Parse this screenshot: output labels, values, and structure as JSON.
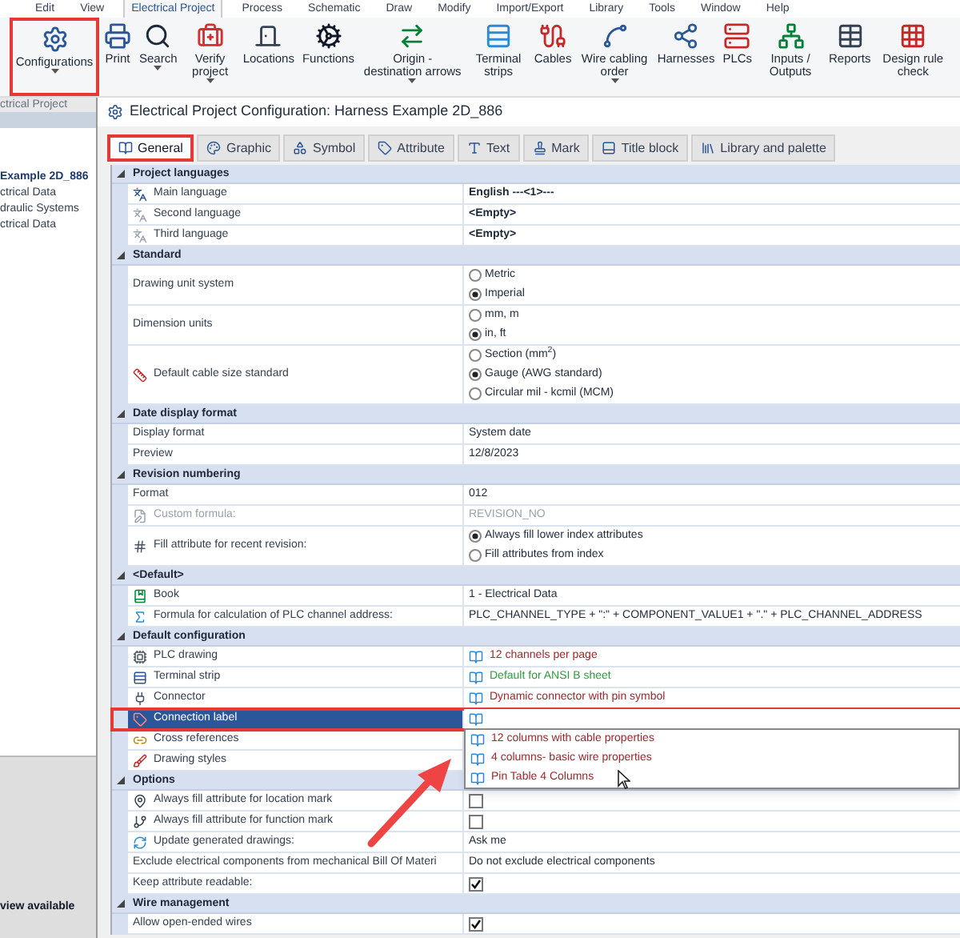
{
  "menu_tabs": [
    {
      "label": "Edit",
      "selected": false
    },
    {
      "label": "View",
      "selected": false
    },
    {
      "label": "Electrical Project",
      "selected": true
    },
    {
      "label": "Process",
      "selected": false
    },
    {
      "label": "Schematic",
      "selected": false
    },
    {
      "label": "Draw",
      "selected": false
    },
    {
      "label": "Modify",
      "selected": false
    },
    {
      "label": "Import/Export",
      "selected": false
    },
    {
      "label": "Library",
      "selected": false
    },
    {
      "label": "Tools",
      "selected": false
    },
    {
      "label": "Window",
      "selected": false
    },
    {
      "label": "Help",
      "selected": false
    }
  ],
  "ribbon": {
    "buttons": [
      {
        "label": "Configurations",
        "kind": "configurations",
        "dropdown": true,
        "annotated": true
      },
      {
        "label": "Print",
        "kind": "print",
        "dropdown": false,
        "annotated": false
      },
      {
        "label": "Search",
        "kind": "search",
        "dropdown": true,
        "annotated": false
      },
      {
        "label": "Verify project",
        "kind": "verify",
        "dropdown": true,
        "annotated": false
      },
      {
        "label": "Locations",
        "kind": "locations",
        "dropdown": false,
        "annotated": false
      },
      {
        "label": "Functions",
        "kind": "functions",
        "dropdown": false,
        "annotated": false
      },
      {
        "label": "Origin - destination arrows",
        "kind": "arrows",
        "dropdown": true,
        "annotated": false
      },
      {
        "label": "Terminal strips",
        "kind": "terminals",
        "dropdown": false,
        "annotated": false
      },
      {
        "label": "Cables",
        "kind": "cables",
        "dropdown": false,
        "annotated": false
      },
      {
        "label": "Wire cabling order",
        "kind": "wires",
        "dropdown": true,
        "annotated": false
      },
      {
        "label": "Harnesses",
        "kind": "harnesses",
        "dropdown": false,
        "annotated": false
      },
      {
        "label": "PLCs",
        "kind": "plcs",
        "dropdown": false,
        "annotated": false
      },
      {
        "label": "Inputs / Outputs",
        "kind": "io",
        "dropdown": false,
        "annotated": false
      },
      {
        "label": "Reports",
        "kind": "reports",
        "dropdown": false,
        "annotated": false
      },
      {
        "label": "Design rule check",
        "kind": "drc",
        "dropdown": false,
        "annotated": false
      }
    ],
    "group_label": "ctrical Project"
  },
  "tree": {
    "items": [
      {
        "label": "Example 2D_886",
        "kind": "project"
      },
      {
        "label": "ctrical Data",
        "kind": "book"
      },
      {
        "label": "draulic Systems",
        "kind": "book"
      },
      {
        "label": "ctrical Data",
        "kind": "book"
      }
    ]
  },
  "preview_text": "view available",
  "dialog": {
    "title": "Electrical Project Configuration: Harness Example 2D_886",
    "tabs": [
      {
        "label": "General",
        "selected": true,
        "annotated": true
      },
      {
        "label": "Graphic",
        "selected": false,
        "annotated": false
      },
      {
        "label": "Symbol",
        "selected": false,
        "annotated": false
      },
      {
        "label": "Attribute",
        "selected": false,
        "annotated": false
      },
      {
        "label": "Text",
        "selected": false,
        "annotated": false
      },
      {
        "label": "Mark",
        "selected": false,
        "annotated": false
      },
      {
        "label": "Title block",
        "selected": false,
        "annotated": false
      },
      {
        "label": "Library and palette",
        "selected": false,
        "annotated": false
      }
    ],
    "sections": [
      {
        "title": "Project languages",
        "rows": [
          {
            "label": "Main language",
            "kind": "text",
            "value": "English  ---<1>---",
            "bold": true,
            "disabled": false,
            "selected": false
          },
          {
            "label": "Second language",
            "kind": "text",
            "value": "<Empty>",
            "bold": true,
            "disabled": false,
            "selected": false
          },
          {
            "label": "Third language",
            "kind": "text",
            "value": "<Empty>",
            "bold": true,
            "disabled": false,
            "selected": false
          }
        ]
      },
      {
        "title": "Standard",
        "rows": [
          {
            "label": "Drawing unit system",
            "kind": "radio",
            "options": [
              {
                "label": "Metric",
                "selected": false
              },
              {
                "label": "Imperial",
                "selected": true
              }
            ],
            "disabled": false,
            "selected": false
          },
          {
            "label": "Dimension units",
            "kind": "radio",
            "options": [
              {
                "label": "mm, m",
                "selected": false
              },
              {
                "label": "in, ft",
                "selected": true
              }
            ],
            "disabled": false,
            "selected": false
          },
          {
            "label": "Default cable size standard",
            "kind": "radio",
            "options": [
              {
                "label": "Section (mm$^{2}$)",
                "selected": false
              },
              {
                "label": "Gauge (AWG standard)",
                "selected": true
              },
              {
                "label": "Circular mil - kcmil (MCM)",
                "selected": false
              }
            ],
            "disabled": false,
            "selected": false
          }
        ]
      },
      {
        "title": "Date display format",
        "rows": [
          {
            "label": "Display format",
            "kind": "text",
            "value": "System date",
            "bold": false,
            "disabled": false,
            "selected": false
          },
          {
            "label": "Preview",
            "kind": "text",
            "value": "12/8/2023",
            "bold": false,
            "disabled": false,
            "selected": false
          }
        ]
      },
      {
        "title": "Revision numbering",
        "rows": [
          {
            "label": "Format",
            "kind": "text",
            "value": "012",
            "bold": false,
            "disabled": false,
            "selected": false
          },
          {
            "label": "Custom formula:",
            "kind": "text",
            "value": "REVISION_NO",
            "bold": false,
            "disabled": true,
            "selected": false
          },
          {
            "label": "Fill attribute for recent revision:",
            "kind": "radio",
            "options": [
              {
                "label": "Always fill lower index attributes",
                "selected": true
              },
              {
                "label": "Fill attributes from index",
                "selected": false
              }
            ],
            "disabled": false,
            "selected": false
          }
        ]
      },
      {
        "title": "<Default>",
        "rows": [
          {
            "label": "Book",
            "kind": "text",
            "value": "1 - Electrical Data",
            "bold": false,
            "disabled": false,
            "selected": false
          },
          {
            "label": "Formula for calculation of PLC channel address:",
            "kind": "text",
            "value": "PLC_CHANNEL_TYPE + \":\" + COMPONENT_VALUE1 + \".\" + PLC_CHANNEL_ADDRESS",
            "bold": false,
            "disabled": false,
            "selected": false
          }
        ]
      },
      {
        "title": "Default configuration",
        "rows": [
          {
            "label": "PLC drawing",
            "kind": "link",
            "value": "12 channels per page",
            "color": "#a4262c",
            "disabled": false,
            "selected": false
          },
          {
            "label": "Terminal strip",
            "kind": "link",
            "value": "Default for ANSI B sheet",
            "color": "#2e9e3e",
            "disabled": false,
            "selected": false
          },
          {
            "label": "Connector",
            "kind": "link",
            "value": "Dynamic connector with pin symbol",
            "color": "#a4262c",
            "disabled": false,
            "selected": false
          },
          {
            "label": "Connection label",
            "kind": "dropdown",
            "options": [
              {
                "label": "12 columns with cable properties",
                "color": "#a4262c"
              },
              {
                "label": "4 columns- basic wire properties",
                "color": "#a4262c"
              },
              {
                "label": "Pin Table 4 Columns",
                "color": "#a4262c"
              }
            ],
            "disabled": false,
            "selected": true,
            "annotated": true
          },
          {
            "label": "Cross references",
            "kind": "label",
            "disabled": false,
            "selected": false
          },
          {
            "label": "Drawing styles",
            "kind": "label",
            "disabled": false,
            "selected": false
          }
        ]
      },
      {
        "title": "Options",
        "rows": [
          {
            "label": "Always fill attribute for location mark",
            "kind": "checkbox",
            "checked": false,
            "disabled": false,
            "selected": false
          },
          {
            "label": "Always fill attribute for function mark",
            "kind": "checkbox",
            "checked": false,
            "disabled": false,
            "selected": false
          },
          {
            "label": "Update generated drawings:",
            "kind": "text",
            "value": "Ask me",
            "bold": false,
            "disabled": false,
            "selected": false
          },
          {
            "label": "Exclude electrical components from mechanical Bill Of Materi",
            "kind": "text",
            "value": "Do not exclude electrical components",
            "bold": false,
            "disabled": false,
            "selected": false
          },
          {
            "label": "Keep attribute readable:",
            "kind": "checkbox",
            "checked": true,
            "disabled": false,
            "selected": false
          }
        ]
      },
      {
        "title": "Wire management",
        "rows": [
          {
            "label": "Allow open-ended wires",
            "kind": "checkbox",
            "checked": true,
            "disabled": false,
            "selected": false
          }
        ]
      }
    ]
  }
}
